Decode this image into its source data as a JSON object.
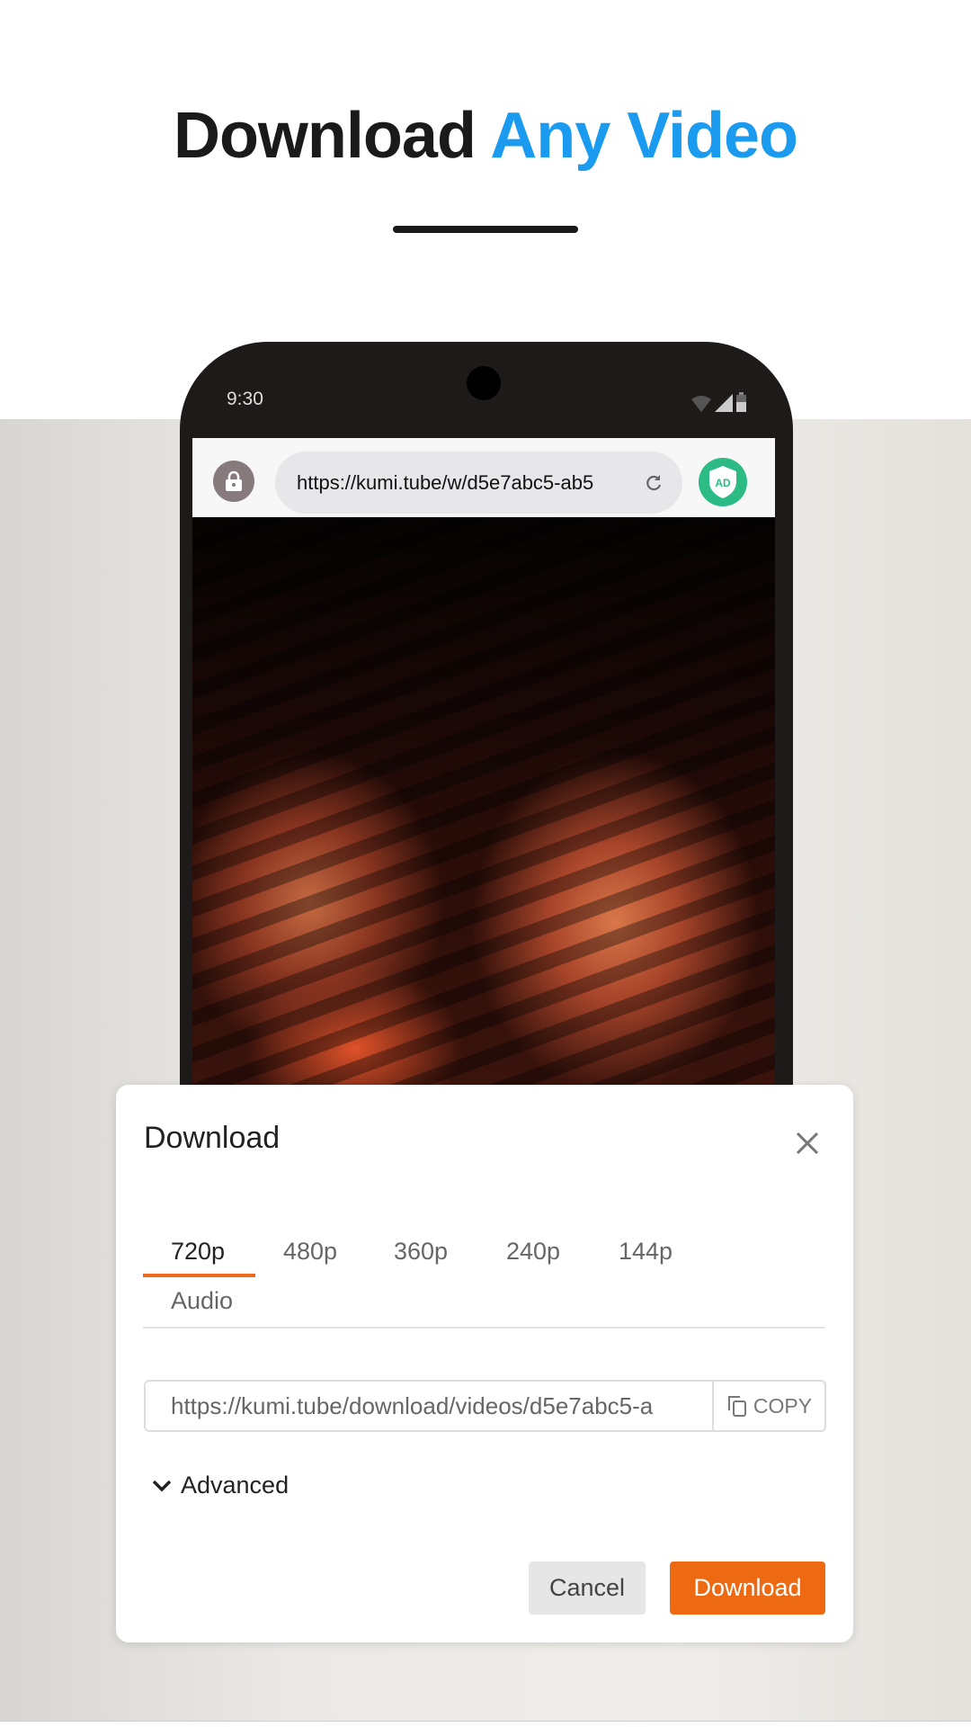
{
  "headline": {
    "part1": "Download",
    "part2": "Any Video",
    "accent_color": "#1a9bf0"
  },
  "status_bar": {
    "time": "9:30",
    "icons": [
      "wifi-icon",
      "signal-icon",
      "battery-icon"
    ]
  },
  "browser": {
    "url": "https://kumi.tube/w/d5e7abc5-ab5",
    "icons": [
      "lock-icon",
      "reload-icon",
      "ad-block-shield-icon"
    ],
    "ad_badge": "AD",
    "ad_color": "#2dbb85"
  },
  "dialog": {
    "title": "Download",
    "tabs": [
      {
        "label": "720p",
        "active": true
      },
      {
        "label": "480p"
      },
      {
        "label": "360p"
      },
      {
        "label": "240p"
      },
      {
        "label": "144p"
      },
      {
        "label": "Audio"
      }
    ],
    "link_value": "https://kumi.tube/download/videos/d5e7abc5-a",
    "copy_label": "COPY",
    "advanced_label": "Advanced",
    "cancel_label": "Cancel",
    "download_label": "Download",
    "accent_color": "#ee6a12"
  }
}
